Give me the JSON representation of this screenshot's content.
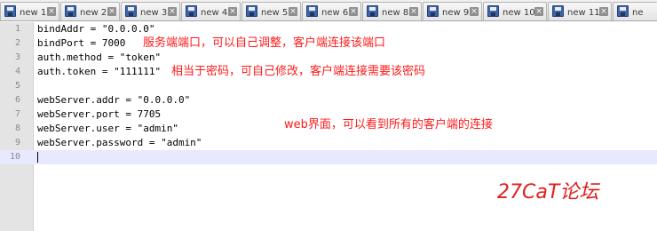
{
  "tabs": [
    {
      "label": "new 1",
      "icon": "disk-icon"
    },
    {
      "label": "new 2",
      "icon": "disk-icon"
    },
    {
      "label": "new 3",
      "icon": "disk-icon"
    },
    {
      "label": "new 4",
      "icon": "disk-icon"
    },
    {
      "label": "new 5",
      "icon": "disk-icon"
    },
    {
      "label": "new 6",
      "icon": "disk-icon"
    },
    {
      "label": "new 8",
      "icon": "disk-icon"
    },
    {
      "label": "new 9",
      "icon": "disk-icon"
    },
    {
      "label": "new 10",
      "icon": "disk-icon"
    },
    {
      "label": "new 11",
      "icon": "disk-icon"
    },
    {
      "label": "ne",
      "icon": "disk-icon"
    }
  ],
  "editor": {
    "lines": [
      {
        "num": "1",
        "text": "bindAddr = \"0.0.0.0\""
      },
      {
        "num": "2",
        "text": "bindPort = 7000"
      },
      {
        "num": "3",
        "text": "auth.method = \"token\""
      },
      {
        "num": "4",
        "text": "auth.token = \"111111\""
      },
      {
        "num": "5",
        "text": ""
      },
      {
        "num": "6",
        "text": "webServer.addr = \"0.0.0.0\""
      },
      {
        "num": "7",
        "text": "webServer.port = 7705"
      },
      {
        "num": "8",
        "text": "webServer.user = \"admin\""
      },
      {
        "num": "9",
        "text": "webServer.password = \"admin\""
      },
      {
        "num": "10",
        "text": ""
      }
    ],
    "current_line": "10"
  },
  "annotations": {
    "port_note": "服务端端口，可以自己调整，客户端连接该端口",
    "token_note": "相当于密码，可自己修改，客户端连接需要该密码",
    "web_note": "web界面，可以看到所有的客户端的连接"
  },
  "watermark": "27CaT论坛",
  "colors": {
    "annotation": "#ff1a1a",
    "current_line_highlight": "#e8e8ff",
    "gutter": "#e4e4e4"
  }
}
